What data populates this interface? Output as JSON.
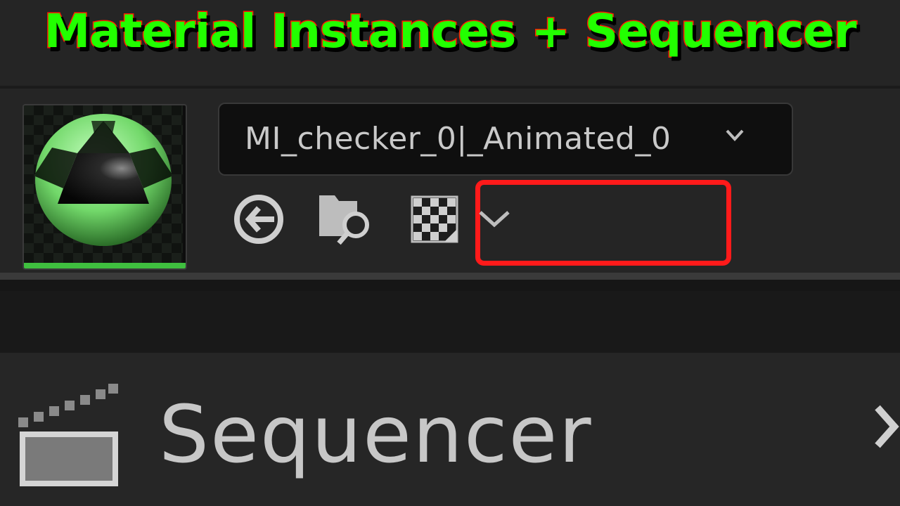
{
  "banner": {
    "title": "Material Instances + Sequencer"
  },
  "asset": {
    "combo_value": "MI_checker_0|_Animated_0",
    "icons": [
      "material-sphere-thumbnail",
      "use-selected-arrow-icon",
      "browse-folder-icon",
      "checker-texture-icon",
      "chevron-down-icon"
    ]
  },
  "sequencer": {
    "label": "Sequencer",
    "icons": [
      "clapperboard-icon",
      "chevron-right-icon"
    ]
  },
  "colors": {
    "accent_highlight": "#ff1a1a",
    "title_fill": "#22ff00",
    "title_stroke": "#ff1a00",
    "thumbnail_bar": "#3fbf3f"
  }
}
